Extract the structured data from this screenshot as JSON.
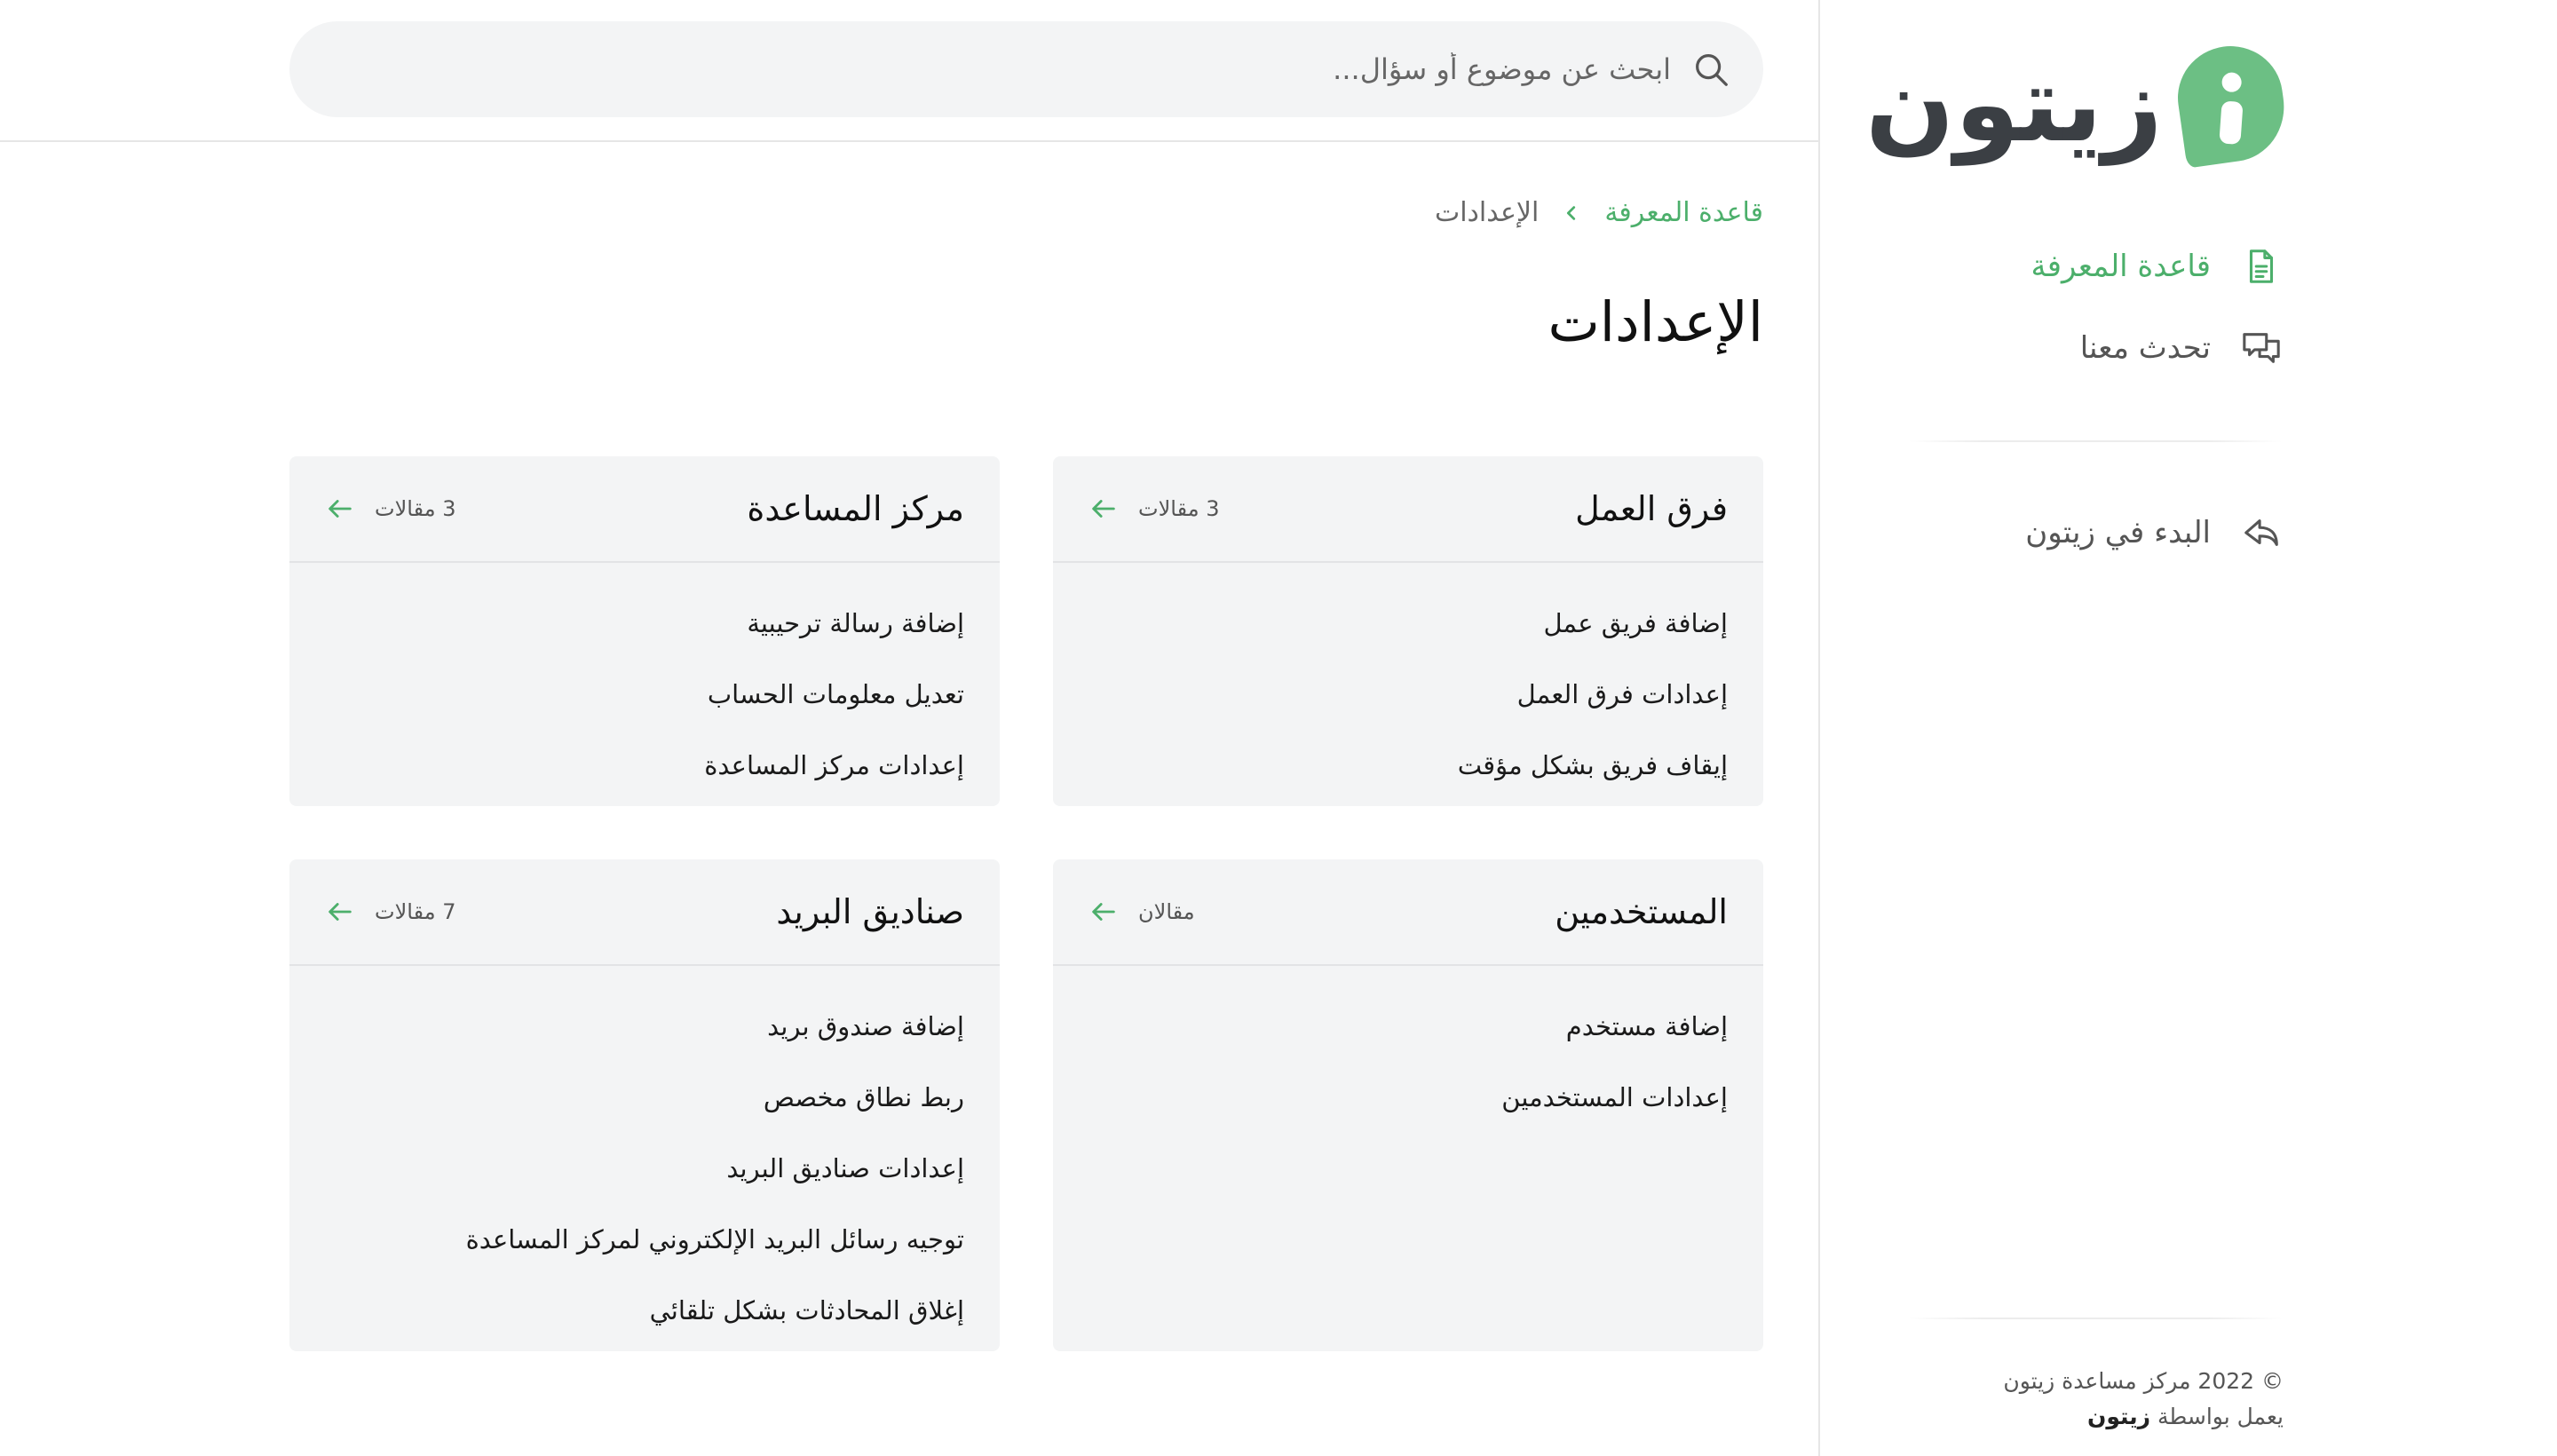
{
  "colors": {
    "accent": "#4caf6b",
    "logo_green": "#6cbf84",
    "card_bg": "#f3f4f5",
    "search_bg": "#f3f4f5"
  },
  "brand": {
    "name": "زيتون"
  },
  "sidebar": {
    "nav": [
      {
        "label": "قاعدة المعرفة",
        "icon": "document-icon",
        "active": true
      },
      {
        "label": "تحدث معنا",
        "icon": "chat-icon",
        "active": false
      }
    ],
    "secondary": [
      {
        "label": "البدء في زيتون",
        "icon": "share-arrow-icon"
      }
    ],
    "footer": {
      "copyright": "© 2022 مركز مساعدة زيتون",
      "powered_prefix": "يعمل بواسطة",
      "powered_brand": "زيتون"
    }
  },
  "search": {
    "placeholder": "ابحث عن موضوع أو سؤال..."
  },
  "breadcrumb": {
    "root": "قاعدة المعرفة",
    "current": "الإعدادات"
  },
  "page": {
    "title": "الإعدادات"
  },
  "cards": [
    {
      "title": "فرق العمل",
      "count": "3 مقالات",
      "articles": [
        "إضافة فريق عمل",
        "إعدادات فرق العمل",
        "إيقاف فريق بشكل مؤقت"
      ]
    },
    {
      "title": "مركز المساعدة",
      "count": "3 مقالات",
      "articles": [
        "إضافة رسالة ترحيبية",
        "تعديل معلومات الحساب",
        "إعدادات مركز المساعدة"
      ]
    },
    {
      "title": "المستخدمين",
      "count": "مقالان",
      "articles": [
        "إضافة مستخدم",
        "إعدادات المستخدمين"
      ]
    },
    {
      "title": "صناديق البريد",
      "count": "7 مقالات",
      "articles": [
        "إضافة صندوق بريد",
        "ربط نطاق مخصص",
        "إعدادات صناديق البريد",
        "توجيه رسائل البريد الإلكتروني لمركز المساعدة",
        "إغلاق المحادثات بشكل تلقائي"
      ]
    }
  ]
}
